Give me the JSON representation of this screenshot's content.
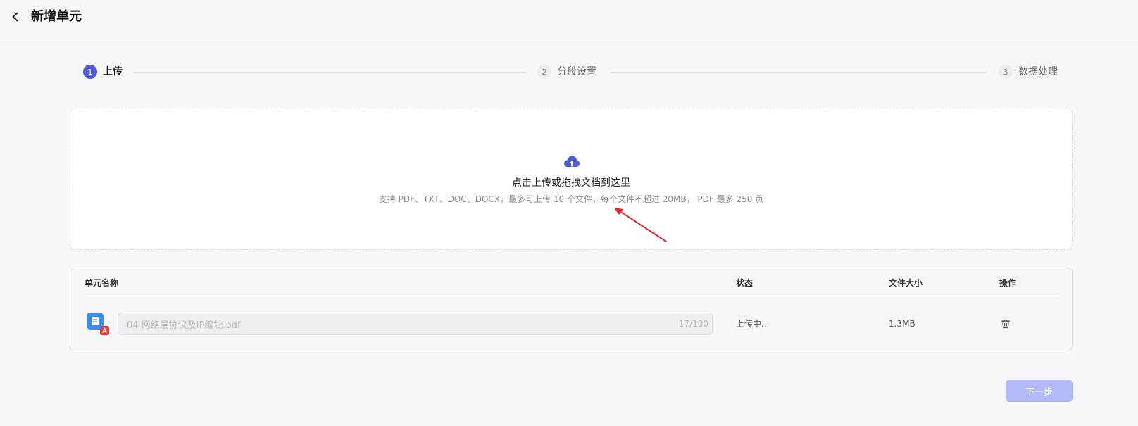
{
  "header": {
    "title": "新增单元"
  },
  "stepper": {
    "steps": [
      {
        "num": "1",
        "label": "上传",
        "active": true
      },
      {
        "num": "2",
        "label": "分段设置",
        "active": false
      },
      {
        "num": "3",
        "label": "数据处理",
        "active": false
      }
    ]
  },
  "upload": {
    "icon": "cloud-upload-icon",
    "title": "点击上传或拖拽文档到这里",
    "hint": "支持 PDF、TXT、DOC、DOCX，最多可上传 10 个文件，每个文件不超过 20MB， PDF 最多 250 页"
  },
  "table": {
    "columns": [
      "单元名称",
      "状态",
      "文件大小",
      "操作"
    ],
    "rows": [
      {
        "name": "04 网络层协议及IP编址.pdf",
        "counter": "17/100",
        "status": "上传中...",
        "size": "1.3MB",
        "action_icon": "trash-icon"
      }
    ]
  },
  "footer": {
    "next_label": "下一步"
  },
  "colors": {
    "accent": "#4f5bd5",
    "next_disabled": "#b3b8f6",
    "annotation_arrow": "#e0262b",
    "pdf_badge": "#e5413b",
    "doc_icon": "#3b8cf0"
  }
}
